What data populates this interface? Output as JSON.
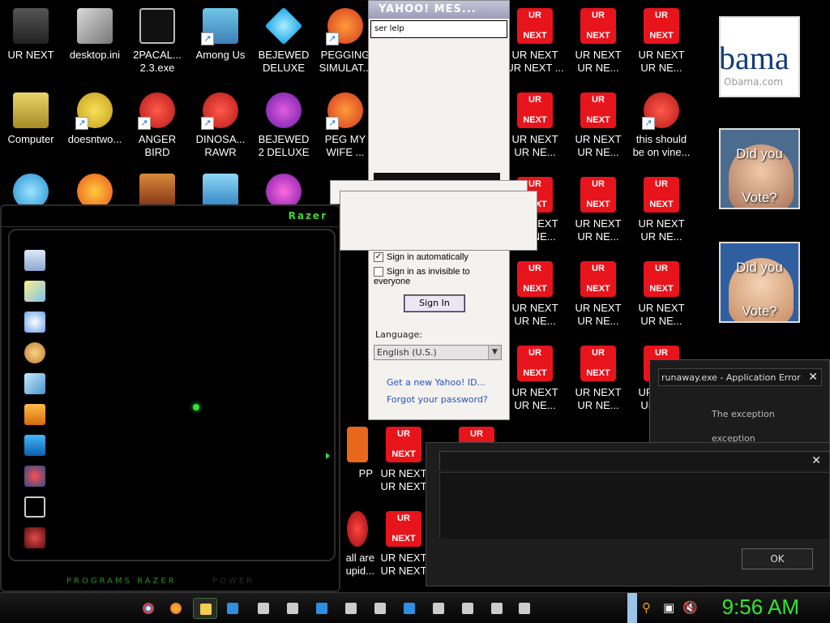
{
  "desktop": {
    "icons_row1": [
      {
        "label": "UR NEXT",
        "icon": "dark-figure-icon"
      },
      {
        "label": "desktop.ini",
        "icon": "settings-file-icon"
      },
      {
        "label": "2PACAL...\n2.3.exe",
        "icon": "console-app-icon"
      },
      {
        "label": "Among Us",
        "icon": "game-icon"
      },
      {
        "label": "BEJEWED\nDELUXE",
        "icon": "diamond-icon"
      },
      {
        "label": "PEGGING\nSIMULAT...",
        "icon": "peggle-icon"
      }
    ],
    "icons_row2": [
      {
        "label": "Computer",
        "icon": "computer-icon"
      },
      {
        "label": "doesntwo...",
        "icon": "yahoo-icon"
      },
      {
        "label": "ANGER\nBIRD",
        "icon": "angry-bird-icon"
      },
      {
        "label": "DINOSA...\nRAWR",
        "icon": "angry-bird-icon"
      },
      {
        "label": "BEJEWED\n2 DELUXE",
        "icon": "bejeweled-2-icon"
      },
      {
        "label": "PEG MY\nWIFE ...",
        "icon": "peggle-icon"
      }
    ],
    "red_tile_top": "UR",
    "red_tile_bottom": "NEXT",
    "red_grid": [
      {
        "label": "UR NEXT\nUR NEXT ..."
      },
      {
        "label": "UR NEXT\nUR NE..."
      },
      {
        "label": "UR NEXT\nUR NE..."
      },
      {
        "label": "UR NEXT\nUR NE..."
      },
      {
        "label": "UR NEXT\nUR NE..."
      },
      {
        "label": "this should\nbe on vine..."
      },
      {
        "label": "UR NEXT\nUR NE..."
      },
      {
        "label": "UR NEXT\nUR NE..."
      },
      {
        "label": "UR NEXT\nUR NE..."
      },
      {
        "label": "UR NEXT\nUR NE..."
      },
      {
        "label": "UR NEXT\nUR NE..."
      },
      {
        "label": "UR NEXT\nUR NE..."
      },
      {
        "label": "UR NEXT\nUR NE..."
      },
      {
        "label": "UR NEXT\nUR NE..."
      },
      {
        "label": "UR NEXT\nUR NE..."
      }
    ],
    "bottom_icons": [
      {
        "label": "UR NEXT\nUR NEXT"
      },
      {
        "label": "UR NEXT\nUR NEXT"
      }
    ],
    "partial_labels": [
      "PP",
      "all are\nupid..."
    ]
  },
  "yahoo": {
    "title": "YAHOO! MES...",
    "user_field": "ser lelp",
    "sign_in_auto": "Sign in automatically",
    "sign_in_auto_checked": true,
    "sign_in_invisible": "Sign in as invisible to everyone",
    "sign_in_button": "Sign In",
    "language_label": "Language:",
    "language_value": "English (U.S.)",
    "link_new_id": "Get a new Yahoo! ID...",
    "link_forgot": "Forgot your password?"
  },
  "razer": {
    "logo": "Razer",
    "footer_programs": "PROGRAMS  RAZER",
    "footer_power": "POWER"
  },
  "pictures": {
    "obama_caption": "Obama.com",
    "obama_big": "bama",
    "did_you": "Did you",
    "vote": "Vote?"
  },
  "app_error": {
    "title": "runaway.exe - Application Error",
    "line1": "The exception",
    "line2": "exception"
  },
  "dialog": {
    "ok_button": "OK"
  },
  "taskbar": {
    "clock": "9:56 AM"
  }
}
